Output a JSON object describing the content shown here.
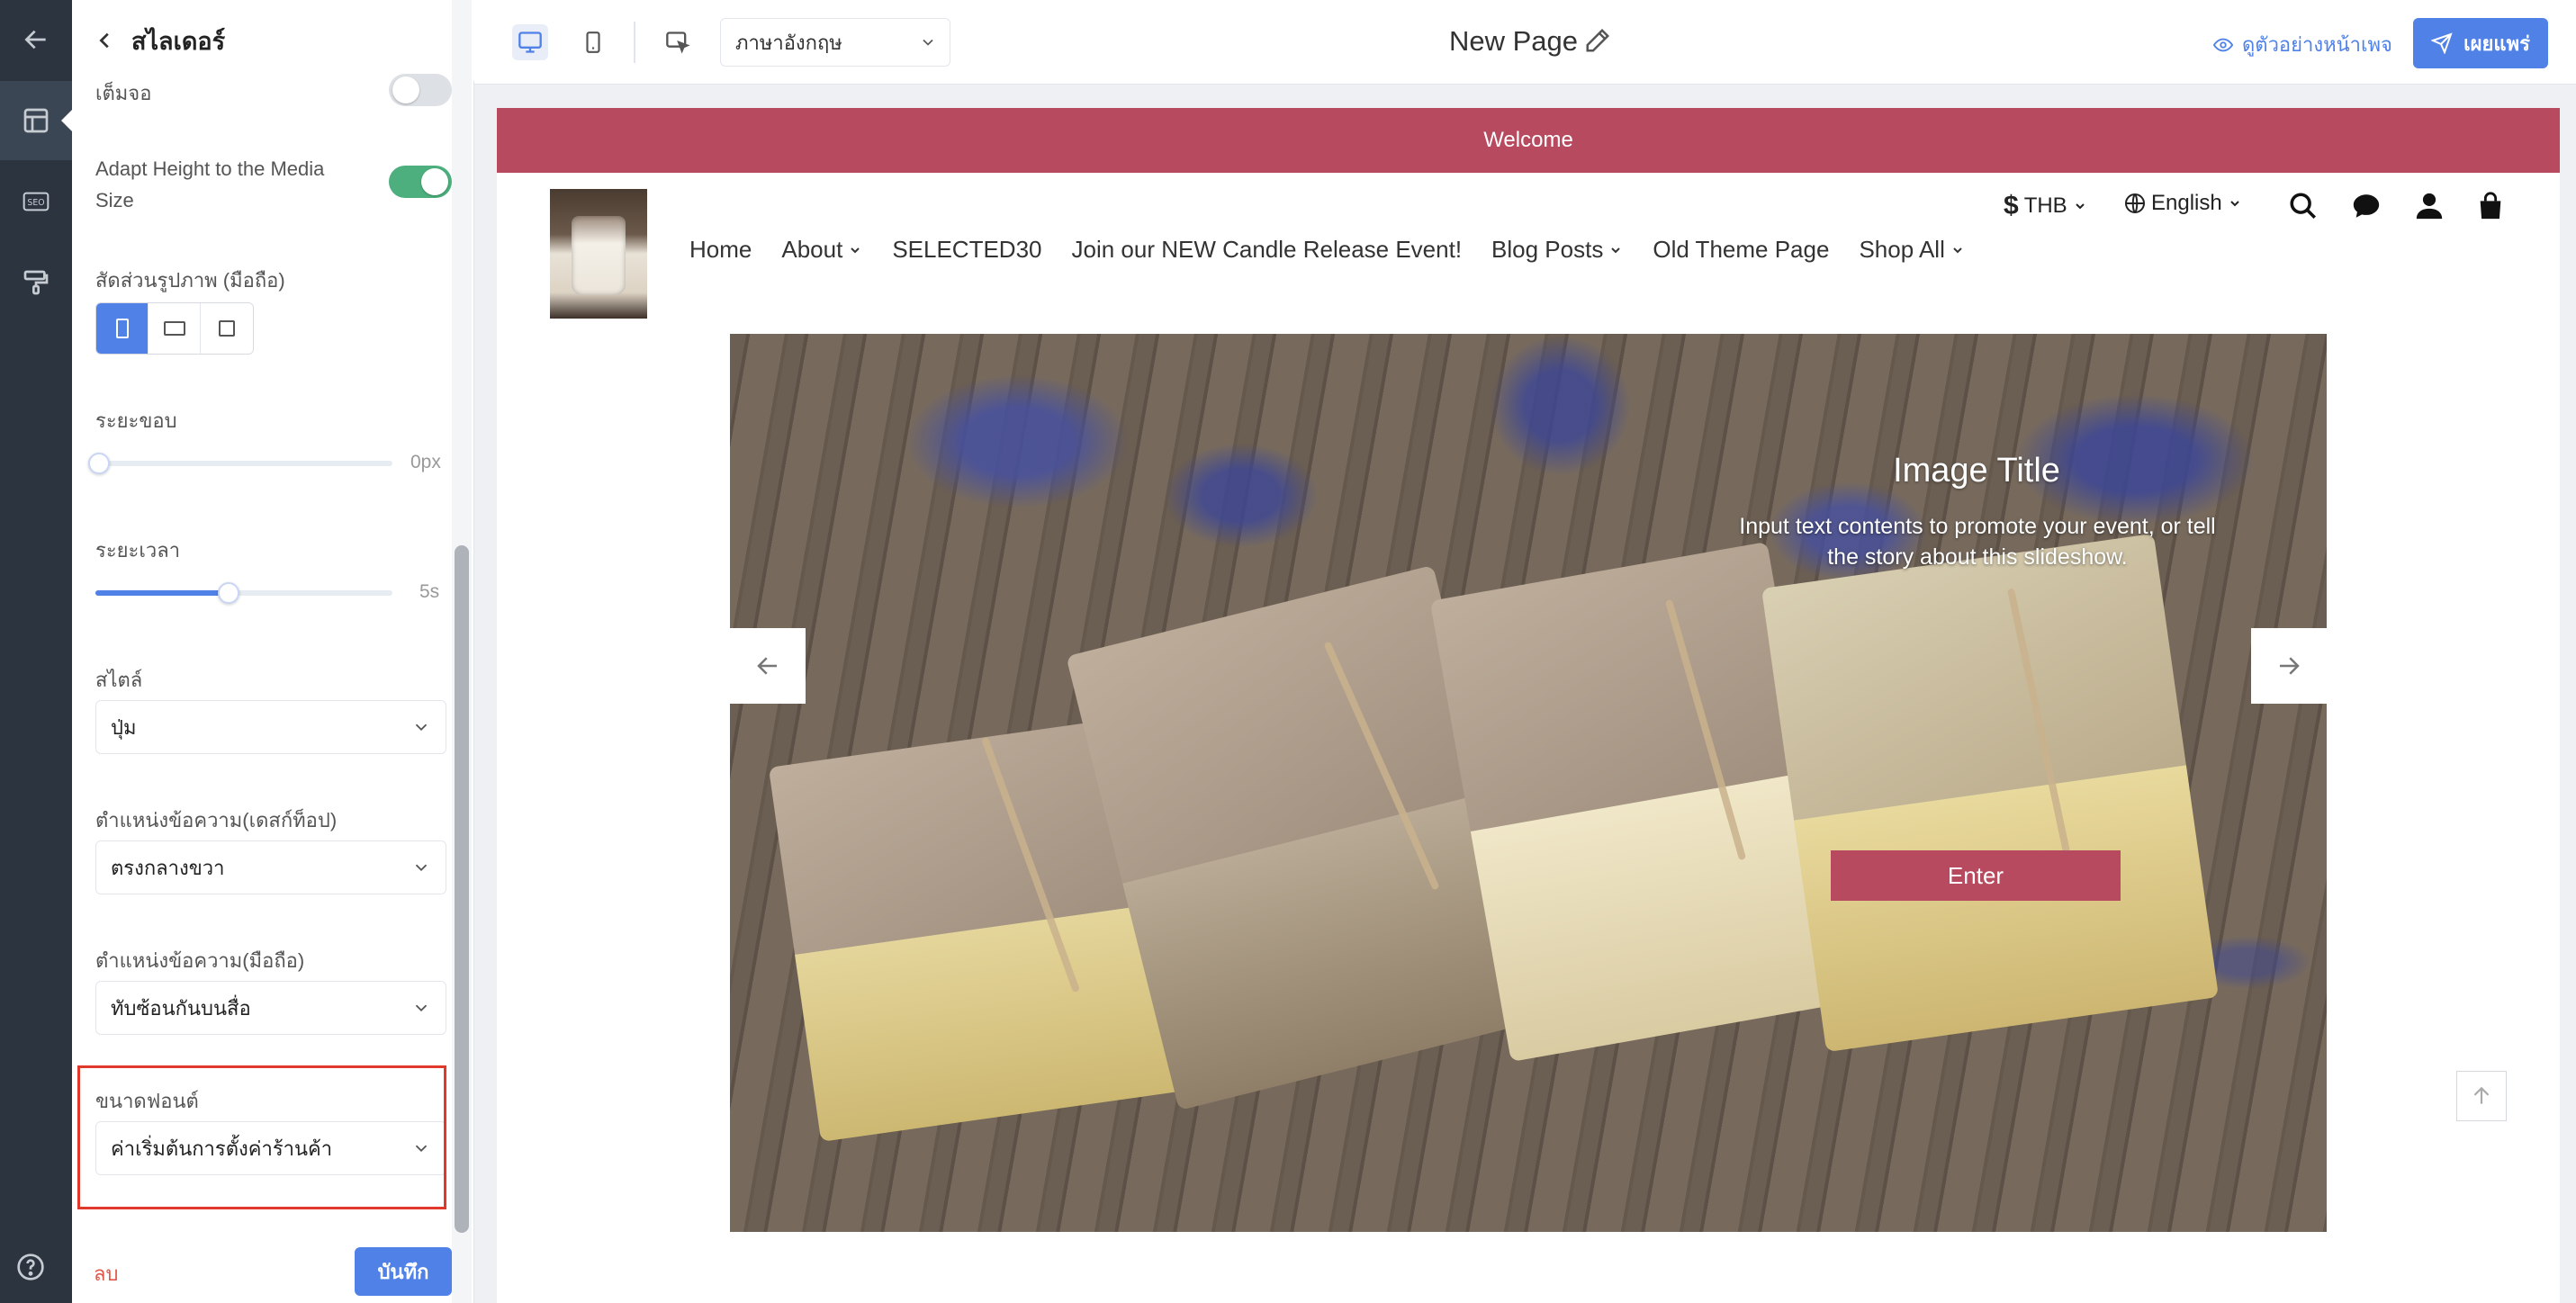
{
  "panel": {
    "title": "สไลเดอร์",
    "fullscreen_label": "เต็มจอ",
    "fullscreen_on": false,
    "adapt_height_label": "Adapt Height to the Media Size",
    "adapt_height_on": true,
    "mobile_ratio_label": "สัดส่วนรูปภาพ (มือถือ)",
    "mobile_ratio_selected": "portrait",
    "margin_label": "ระยะขอบ",
    "margin_value": "0px",
    "margin_fraction": 0,
    "duration_label": "ระยะเวลา",
    "duration_value": "5s",
    "duration_fraction": 0.44,
    "style_label": "สไตล์",
    "style_value": "ปุ่ม",
    "desktop_text_pos_label": "ตำแหน่งข้อความ(เดสก์ท็อป)",
    "desktop_text_pos_value": "ตรงกลางขวา",
    "mobile_text_pos_label": "ตำแหน่งข้อความ(มือถือ)",
    "mobile_text_pos_value": "ทับซ้อนกันบนสื่อ",
    "font_size_label": "ขนาดฟอนต์",
    "font_size_value": "ค่าเริ่มต้นการตั้งค่าร้านค้า",
    "delete_label": "ลบ",
    "save_label": "บันทึก"
  },
  "toolbar": {
    "language": "ภาษาอังกฤษ",
    "page_title": "New Page",
    "preview_label": "ดูตัวอย่างหน้าเพจ",
    "publish_label": "เผยแพร่"
  },
  "store": {
    "announcement": "Welcome",
    "nav": [
      {
        "label": "Home",
        "dropdown": false
      },
      {
        "label": "About",
        "dropdown": true
      },
      {
        "label": "SELECTED30",
        "dropdown": false
      },
      {
        "label": "Join our NEW Candle Release Event!",
        "dropdown": false
      },
      {
        "label": "Blog Posts",
        "dropdown": true
      },
      {
        "label": "Old Theme Page",
        "dropdown": false
      },
      {
        "label": "Shop All",
        "dropdown": true
      }
    ],
    "currency": "THB",
    "language": "English"
  },
  "slide": {
    "title": "Image Title",
    "text": "Input text contents to promote your event, or tell the story about this slideshow.",
    "button": "Enter"
  },
  "colors": {
    "accent": "#4f81e7",
    "brand": "#b84a5f",
    "toggle_on": "#4caf7d",
    "highlight": "#e0392b"
  }
}
